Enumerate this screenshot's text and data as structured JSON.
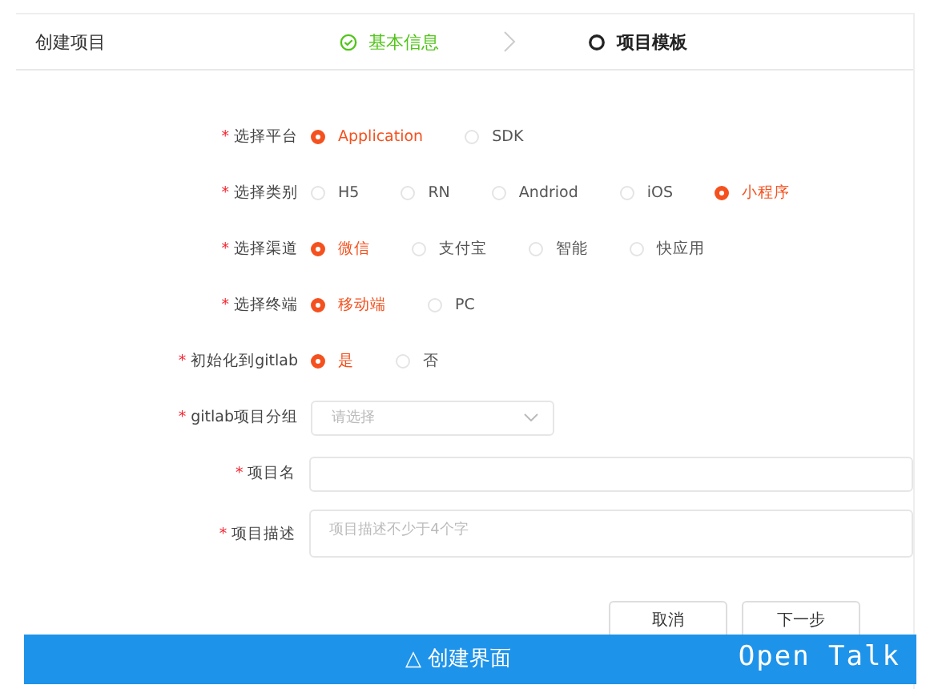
{
  "header": {
    "title": "创建项目",
    "steps": [
      {
        "label": "基本信息",
        "done": true
      },
      {
        "label": "项目模板",
        "done": false
      }
    ]
  },
  "radio_rows": [
    {
      "marker": "*",
      "label": "选择平台",
      "options": [
        {
          "label": "Application",
          "selected": true
        },
        {
          "label": "SDK",
          "selected": false
        }
      ]
    },
    {
      "marker": "*",
      "label": "选择类别",
      "options": [
        {
          "label": "H5",
          "selected": false
        },
        {
          "label": "RN",
          "selected": false
        },
        {
          "label": "Andriod",
          "selected": false
        },
        {
          "label": "iOS",
          "selected": false
        },
        {
          "label": "小程序",
          "selected": true
        }
      ]
    },
    {
      "marker": "*",
      "label": "选择渠道",
      "options": [
        {
          "label": "微信",
          "selected": true
        },
        {
          "label": "支付宝",
          "selected": false
        },
        {
          "label": "智能",
          "selected": false
        },
        {
          "label": "快应用",
          "selected": false
        }
      ]
    },
    {
      "marker": "*",
      "label": "选择终端",
      "options": [
        {
          "label": "移动端",
          "selected": true
        },
        {
          "label": "PC",
          "selected": false
        }
      ]
    },
    {
      "marker": "*",
      "label": "初始化到gitlab",
      "options": [
        {
          "label": "是",
          "selected": true
        },
        {
          "label": "否",
          "selected": false
        }
      ]
    }
  ],
  "select": {
    "marker": "*",
    "label": "gitlab项目分组",
    "placeholder": "请选择"
  },
  "name_field": {
    "marker": "*",
    "label": "项目名"
  },
  "description_field": {
    "marker": "*",
    "label": "项目描述",
    "placeholder": "项目描述不少于4个字"
  },
  "buttons": [
    "取消",
    "下一步"
  ],
  "caption_bar": {
    "title": "△ 创建界面",
    "brand": "Open Talk"
  }
}
